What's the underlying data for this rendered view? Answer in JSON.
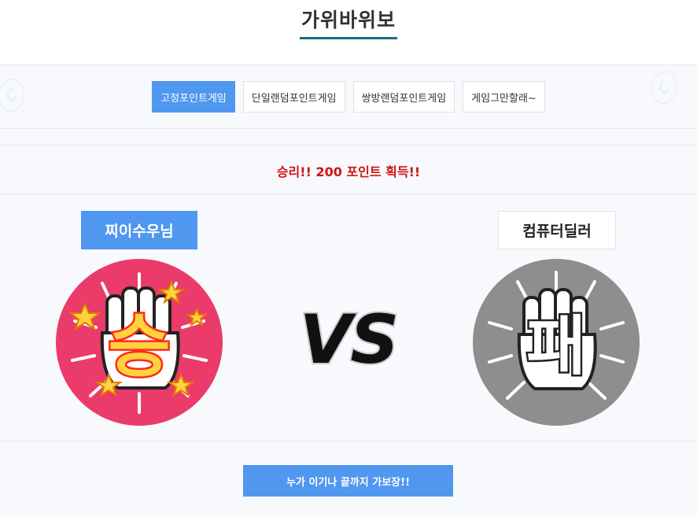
{
  "header": {
    "title": "가위바위보"
  },
  "tabs": [
    {
      "label": "고정포인트게임",
      "active": true
    },
    {
      "label": "단일랜덤포인트게임",
      "active": false
    },
    {
      "label": "쌍방랜덤포인트게임",
      "active": false
    },
    {
      "label": "게임그만할래~",
      "active": false
    }
  ],
  "result": {
    "message": "승리!! 200 포인트 획득!!"
  },
  "player": {
    "name": "찌이수우님",
    "outcome": "승",
    "badge_color": "#ea3b6b",
    "icon": "rock-fist-icon"
  },
  "computer": {
    "name": "컴퓨터딜러",
    "outcome": "패",
    "badge_color": "#8e8e8e",
    "icon": "rock-fist-icon"
  },
  "vs": {
    "label": "VS"
  },
  "action": {
    "button_label": "누가 이기나 끝까지 가보장!!"
  },
  "colors": {
    "accent": "#4f97ef",
    "title_underline": "#1b6d85",
    "result_text": "#d01414"
  }
}
